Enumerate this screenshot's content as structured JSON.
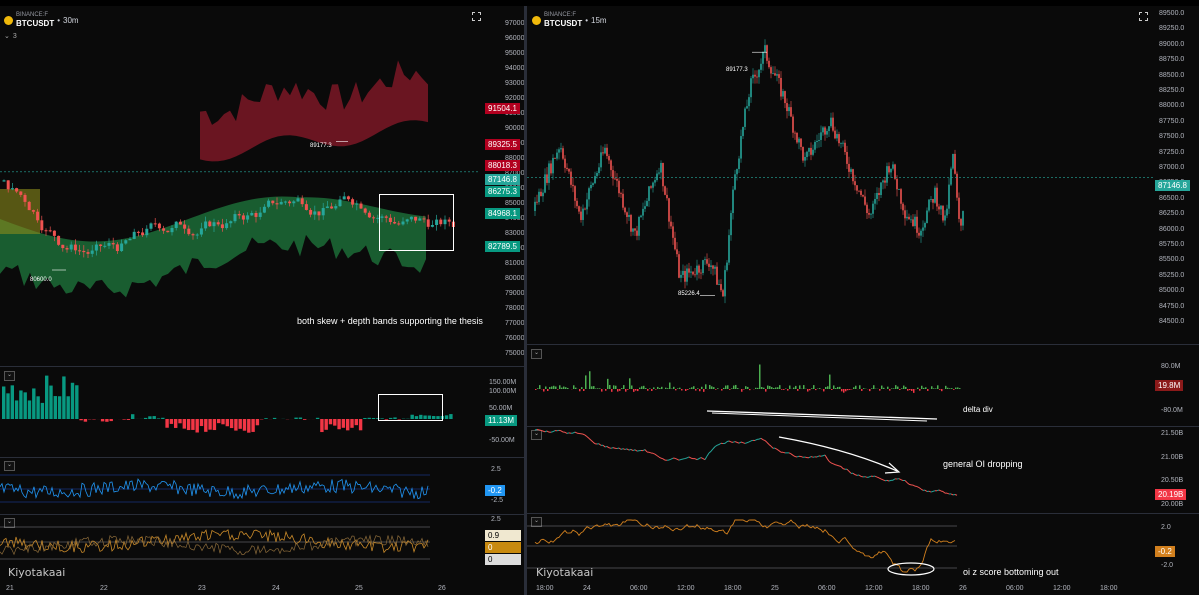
{
  "left_chart": {
    "exchange": "BINANCE:F",
    "symbol": "BTCUSDT",
    "timeframe": "30m",
    "indicator_count": "3",
    "price_ticks": [
      "97000.0",
      "96000.0",
      "95000.0",
      "94000.0",
      "93000.0",
      "92000.0",
      "91000.0",
      "90000.0",
      "89000.0",
      "88000.0",
      "87000.0",
      "86000.0",
      "85000.0",
      "84000.0",
      "83000.0",
      "82000.0",
      "81000.0",
      "80000.0",
      "79000.0",
      "78000.0",
      "77000.0",
      "76000.0",
      "75000.0"
    ],
    "price_labels": [
      {
        "text": "91504.1",
        "color": "#b2001f"
      },
      {
        "text": "89325.5",
        "color": "#b2001f"
      },
      {
        "text": "88018.3",
        "color": "#b2001f"
      },
      {
        "text": "87146.8",
        "color": "#26a69a"
      },
      {
        "text": "86275.3",
        "color": "#089981"
      },
      {
        "text": "84968.1",
        "color": "#089981"
      },
      {
        "text": "82789.5",
        "color": "#089981"
      }
    ],
    "high_label": "89177.3",
    "low_label": "80600.0",
    "annotation": "both skew + depth bands supporting the thesis",
    "delta_ticks": [
      "150.00M",
      "100.00M",
      "50.00M",
      "-50.00M"
    ],
    "delta_value": "11.13M",
    "osc1_ticks": [
      "2.5",
      "-2.5"
    ],
    "osc1_value": "-0.2",
    "osc2_ticks": [
      "2.5"
    ],
    "osc2_values": [
      "0.9",
      "0",
      "0"
    ],
    "x_ticks": [
      "21",
      "22",
      "23",
      "24",
      "25",
      "26"
    ],
    "watermark": "Kiyotakaai"
  },
  "right_chart": {
    "exchange": "BINANCE:F",
    "symbol": "BTCUSDT",
    "timeframe": "15m",
    "price_ticks": [
      "89500.0",
      "89250.0",
      "89000.0",
      "88750.0",
      "88500.0",
      "88250.0",
      "88000.0",
      "87750.0",
      "87500.0",
      "87250.0",
      "87000.0",
      "86750.0",
      "86500.0",
      "86250.0",
      "86000.0",
      "85750.0",
      "85500.0",
      "85250.0",
      "85000.0",
      "84750.0",
      "84500.0"
    ],
    "last_price": "87146.8",
    "high_label": "89177.3",
    "low_label": "85226.4",
    "delta_ticks": [
      "80.0M",
      "-80.0M"
    ],
    "delta_value": "19.8M",
    "delta_annotation": "delta div",
    "oi_ticks": [
      "21.50B",
      "21.00B",
      "20.50B",
      "20.00B"
    ],
    "oi_value": "20.19B",
    "oi_annotation": "general OI dropping",
    "z_ticks": [
      "2.0",
      "-2.0"
    ],
    "z_value": "-0.2",
    "z_annotation": "oi z score bottoming out",
    "x_ticks": [
      "18:00",
      "24",
      "06:00",
      "12:00",
      "18:00",
      "25",
      "06:00",
      "12:00",
      "18:00",
      "26",
      "06:00",
      "12:00",
      "18:00"
    ],
    "watermark": "Kiyotakaai"
  },
  "colors": {
    "up": "#26a69a",
    "down": "#ef5350",
    "red_band": "#8b1a2a",
    "green_band": "#1f7a3e",
    "orange": "#d2801e",
    "blue": "#2962ff",
    "delta_up": "#089981",
    "delta_down": "#f23645"
  }
}
